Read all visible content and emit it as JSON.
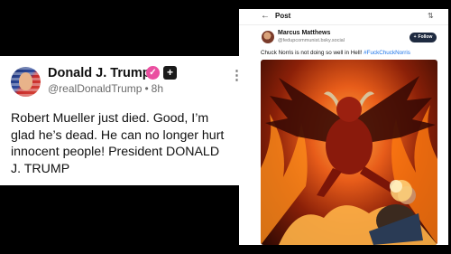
{
  "truth_post": {
    "display_name": "Donald J. Trump",
    "verified_glyph": "✓",
    "plus_glyph": "+",
    "handle": "@realDonaldTrump",
    "separator": "•",
    "time": "8h",
    "more_glyph": "⋮",
    "text": "Robert Mueller just died. Good, I’m glad he’s dead. He can no longer hurt innocent people! President DONALD J. TRUMP"
  },
  "bsky_post": {
    "back_glyph": "←",
    "header_title": "Post",
    "swap_glyph": "⇅",
    "author_name": "Marcus Matthews",
    "author_handle": "@fedupcommunist.bsky.social",
    "follow_plus": "+",
    "follow_label": "Follow",
    "text": "Chuck Norris is not doing so well in Hell! ",
    "hashtag": "#FuckChuckNorris"
  },
  "colors": {
    "verified_badge": "#ea4fa0",
    "hashtag_link": "#1a73e8",
    "follow_button": "#1e2a40"
  },
  "icons": {
    "back": "arrow-left-icon",
    "swap": "swap-vertical-icon",
    "more": "more-vertical-icon",
    "verified": "verified-check-icon",
    "plus": "plus-badge-icon"
  }
}
